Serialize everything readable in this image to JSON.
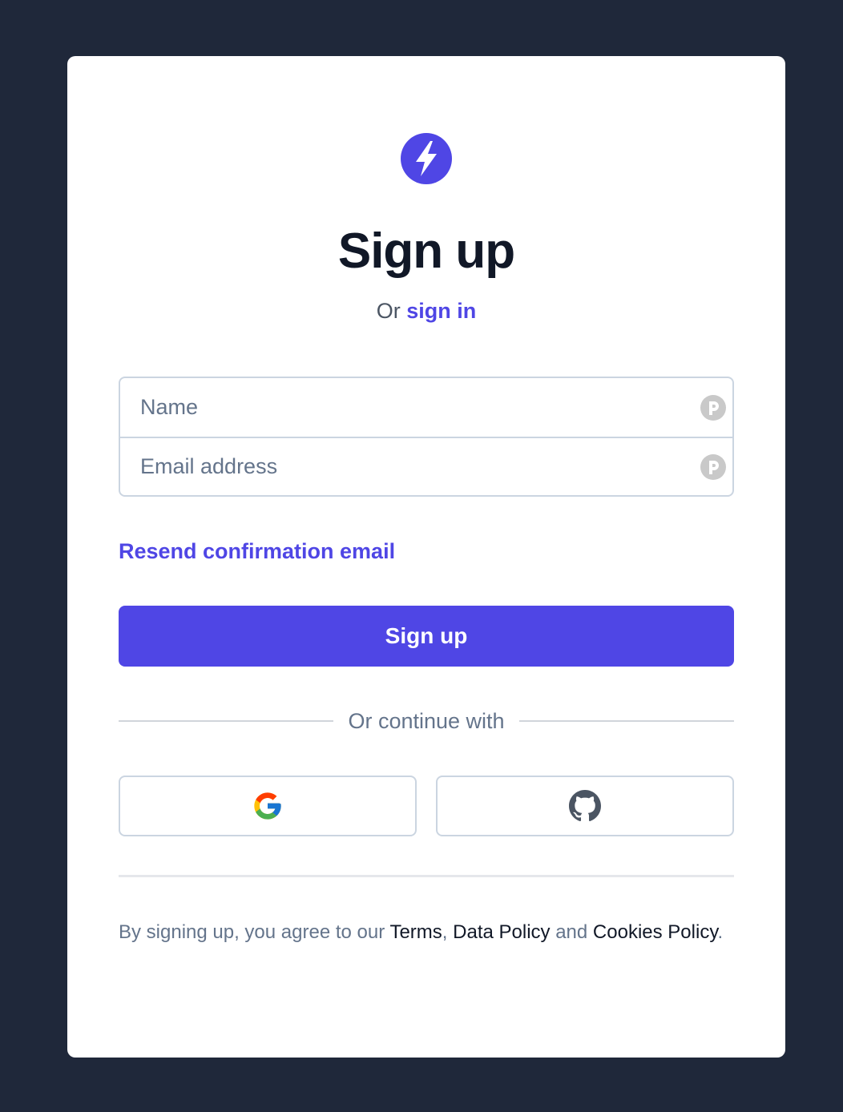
{
  "colors": {
    "background": "#1f283a",
    "card": "#ffffff",
    "accent": "#4f46e5",
    "heading": "#111827",
    "muted": "#64748b",
    "border": "#cbd5e1"
  },
  "logo": {
    "icon": "lightning-bolt-icon"
  },
  "header": {
    "title": "Sign up",
    "subtitle_prefix": "Or",
    "sign_in_link": "sign in"
  },
  "form": {
    "name": {
      "placeholder": "Name",
      "value": "",
      "icon": "password-manager-icon"
    },
    "email": {
      "placeholder": "Email address",
      "value": "",
      "icon": "password-manager-icon"
    },
    "resend_link": "Resend confirmation email",
    "submit_label": "Sign up"
  },
  "divider": {
    "label": "Or continue with"
  },
  "social": {
    "google_icon": "google-icon",
    "github_icon": "github-icon"
  },
  "terms": {
    "prefix": "By signing up, you agree to our",
    "terms_link": "Terms",
    "comma": ",",
    "data_policy_link": "Data Policy",
    "and": "and",
    "cookies_policy_link": "Cookies Policy",
    "period": "."
  }
}
